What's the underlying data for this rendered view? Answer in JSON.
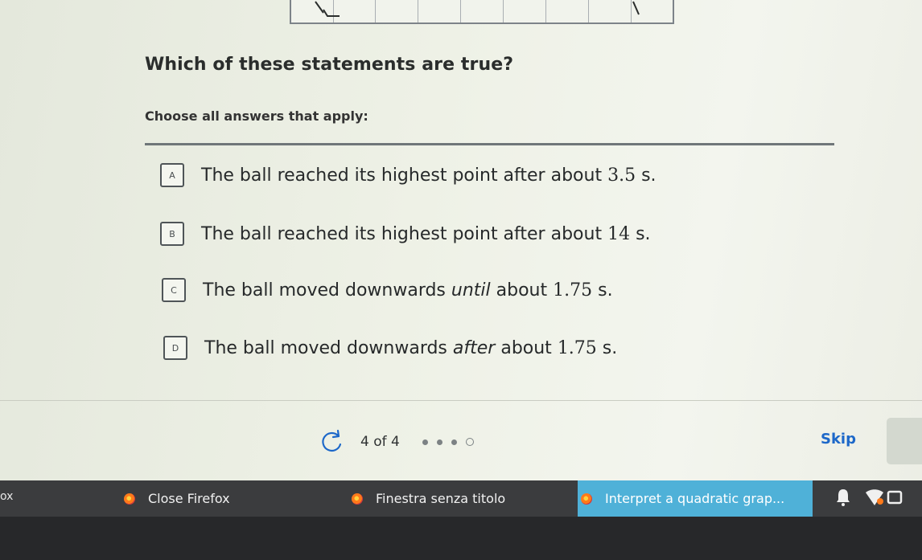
{
  "question": {
    "title": "Which of these statements are true?",
    "instruction": "Choose all answers that apply:"
  },
  "choices": [
    {
      "letter": "A",
      "pre": "The ball reached its highest point after about ",
      "num": "3.5",
      "post": " s."
    },
    {
      "letter": "B",
      "pre": "The ball reached its highest point after about ",
      "num": "14",
      "post": " s."
    },
    {
      "letter": "C",
      "pre": "The ball moved downwards ",
      "em": "until",
      "mid": " about ",
      "num": "1.75",
      "post": " s."
    },
    {
      "letter": "D",
      "pre": "The ball moved downwards ",
      "em": "after",
      "mid": " about ",
      "num": "1.75",
      "post": " s."
    }
  ],
  "progress": {
    "text": "4 of 4",
    "completed": 3,
    "total": 4
  },
  "skip_label": "Skip",
  "taskbar": {
    "fragment": "ox",
    "items": [
      {
        "label": "Close Firefox",
        "active": false
      },
      {
        "label": "Finestra senza titolo",
        "active": false
      },
      {
        "label": "Interpret a quadratic grap...",
        "active": true
      }
    ]
  },
  "colors": {
    "accent_blue": "#1d68c9",
    "taskbar_active": "#4fb1d8",
    "taskbar_bg": "#3b3c3e"
  }
}
